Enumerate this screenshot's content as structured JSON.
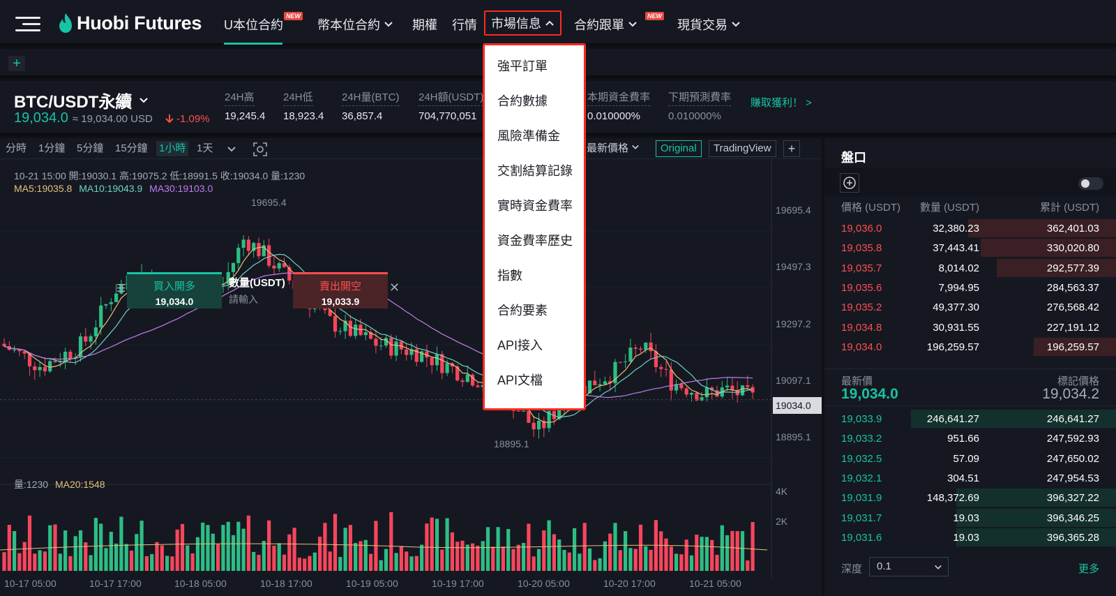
{
  "brand": {
    "name": "Huobi Futures"
  },
  "nav": {
    "items": [
      {
        "label": "U本位合約",
        "badge": "NEW"
      },
      {
        "label": "幣本位合約"
      },
      {
        "label": "期權"
      },
      {
        "label": "行情"
      },
      {
        "label": "市場信息"
      },
      {
        "label": "合約跟單",
        "badge": "NEW"
      },
      {
        "label": "現貨交易"
      }
    ]
  },
  "market_menu": {
    "items": [
      "強平訂單",
      "合約數據",
      "風險準備金",
      "交割結算記錄",
      "實時資金費率",
      "資金費率歷史",
      "指數",
      "合約要素",
      "API接入",
      "API文檔"
    ]
  },
  "ticker": {
    "pair": "BTC/USDT永續",
    "last_price": "19,034.0",
    "usd_price": "≈ 19,034.00 USD",
    "change": "-1.09%",
    "stats": [
      {
        "label": "24H高",
        "value": "19,245.4"
      },
      {
        "label": "24H低",
        "value": "18,923.4"
      },
      {
        "label": "24H量(BTC)",
        "value": "36,857.4"
      },
      {
        "label": "24H額(USDT)",
        "value": "704,770,051"
      },
      {
        "label": "本期資金費率",
        "value": "0.010000%"
      },
      {
        "label": "下期預測費率",
        "value": "0.010000%"
      }
    ],
    "promo": "賺取獲利！ >"
  },
  "chart_toolbar": {
    "timeframes": [
      "分時",
      "1分鐘",
      "5分鐘",
      "15分鐘",
      "1小時",
      "1天"
    ],
    "active_timeframe": "1小時",
    "price_type": "最新價格",
    "original": "Original",
    "tradingview": "TradingView",
    "plus": "+"
  },
  "chart_legend": {
    "ohlc": "10-21 15:00  開:19030.1 高:19075.2 低:18991.5 收:19034.0 量:1230",
    "ma5": "MA5:19035.8",
    "ma10": "MA10:19043.9",
    "ma30": "MA30:19103.0",
    "vol": "量:1230",
    "vol_ma": "MA20:1548"
  },
  "quick_trade": {
    "buy_label": "買入開多",
    "buy_price": "19,034.0",
    "qty_label": "數量(USDT)",
    "qty_placeholder": "請輸入",
    "sell_label": "賣出開空",
    "sell_price": "19,033.9"
  },
  "chart_data": {
    "type": "candlestick",
    "y_ticks": [
      "19695.4",
      "19497.3",
      "19297.2",
      "19097.1",
      "18895.1"
    ],
    "x_ticks": [
      "10-17 05:00",
      "10-17 17:00",
      "10-18 05:00",
      "10-18 17:00",
      "10-19 05:00",
      "10-19 17:00",
      "10-20 05:00",
      "10-20 17:00",
      "10-21 05:00"
    ],
    "vol_ticks": [
      "4K",
      "2K"
    ],
    "current_price": "19034.0",
    "high_marker": "19695.4",
    "low_marker": "18895.1",
    "ylim": [
      18800,
      19780
    ],
    "up_color": "#2dbd85",
    "down_color": "#f6465d"
  },
  "order_book": {
    "title": "盤口",
    "headers": {
      "price": "價格 (USDT)",
      "qty": "數量 (USDT)",
      "total": "累計 (USDT)"
    },
    "asks": [
      {
        "price": "19,036.0",
        "qty": "32,380.23",
        "total": "362,401.03",
        "depth": 0.72
      },
      {
        "price": "19,035.8",
        "qty": "37,443.41",
        "total": "330,020.80",
        "depth": 0.66
      },
      {
        "price": "19,035.7",
        "qty": "8,014.02",
        "total": "292,577.39",
        "depth": 0.58
      },
      {
        "price": "19,035.6",
        "qty": "7,994.95",
        "total": "284,563.37",
        "depth": 0.0
      },
      {
        "price": "19,035.2",
        "qty": "49,377.30",
        "total": "276,568.42",
        "depth": 0.0
      },
      {
        "price": "19,034.8",
        "qty": "30,931.55",
        "total": "227,191.12",
        "depth": 0.0
      },
      {
        "price": "19,034.0",
        "qty": "196,259.57",
        "total": "196,259.57",
        "depth": 0.4
      }
    ],
    "mid": {
      "last_label": "最新價",
      "last_price": "19,034.0",
      "mark_label": "標記價格",
      "mark_price": "19,034.2"
    },
    "bids": [
      {
        "price": "19,033.9",
        "qty": "246,641.27",
        "total": "246,641.27",
        "depth": 1.0
      },
      {
        "price": "19,033.2",
        "qty": "951.66",
        "total": "247,592.93",
        "depth": 0.0
      },
      {
        "price": "19,032.5",
        "qty": "57.09",
        "total": "247,650.02",
        "depth": 0.0
      },
      {
        "price": "19,032.1",
        "qty": "304.51",
        "total": "247,954.53",
        "depth": 0.0
      },
      {
        "price": "19,031.9",
        "qty": "148,372.69",
        "total": "396,327.22",
        "depth": 0.78
      },
      {
        "price": "19,031.7",
        "qty": "19.03",
        "total": "396,346.25",
        "depth": 0.78
      },
      {
        "price": "19,031.6",
        "qty": "19.03",
        "total": "396,365.28",
        "depth": 0.78
      }
    ],
    "depth_label": "深度",
    "depth_value": "0.1",
    "more": "更多"
  }
}
